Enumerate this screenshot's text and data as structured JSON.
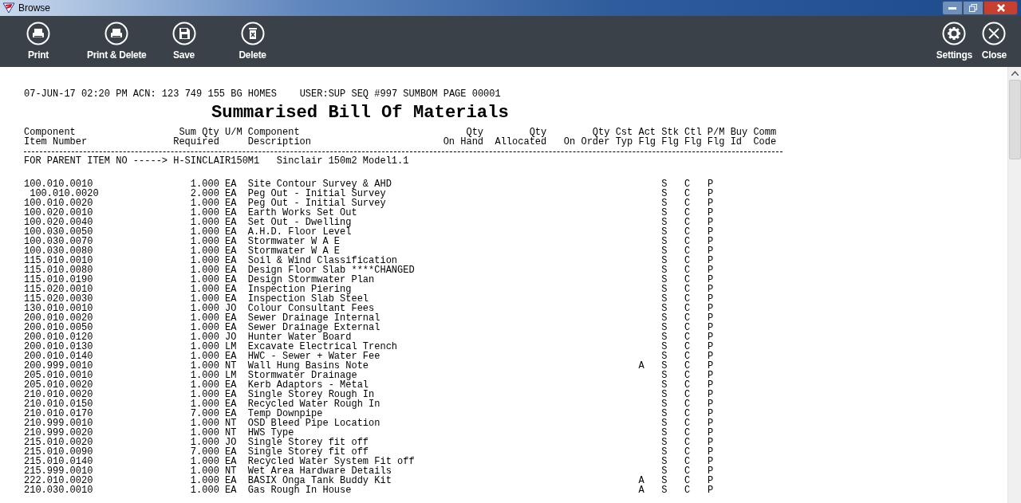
{
  "window": {
    "title": "Browse"
  },
  "toolbar": {
    "left": [
      {
        "label": "Print",
        "kind": "print"
      },
      {
        "label": "Print & Delete",
        "kind": "printdelete"
      },
      {
        "label": "Save",
        "kind": "save"
      },
      {
        "label": "Delete",
        "kind": "delete"
      }
    ],
    "right": [
      {
        "label": "Settings",
        "kind": "settings"
      },
      {
        "label": "Close",
        "kind": "close"
      }
    ]
  },
  "report": {
    "header_left": "07-JUN-17 02:20 PM ACN: 123 749 155  BG HOMES",
    "header_right": "USER:SUP SEQ #997 SUMBOM PAGE 00001",
    "title": "Summarised Bill Of Materials",
    "columns": [
      {
        "lines": [
          "Component",
          "Item Number"
        ]
      },
      {
        "lines": [
          "Sum Qty",
          "Required"
        ]
      },
      {
        "lines": [
          "U/M"
        ]
      },
      {
        "lines": [
          "Component",
          "Description"
        ]
      },
      {
        "lines": [
          "Qty",
          "On Hand"
        ]
      },
      {
        "lines": [
          "Qty",
          "Allocated"
        ]
      },
      {
        "lines": [
          "Qty",
          "On Order"
        ]
      },
      {
        "lines": [
          "Cst",
          "Typ"
        ]
      },
      {
        "lines": [
          "Act",
          "Flg"
        ]
      },
      {
        "lines": [
          "Stk",
          "Flg"
        ]
      },
      {
        "lines": [
          "Ctl",
          "Flg"
        ]
      },
      {
        "lines": [
          "P/M",
          "Flg"
        ]
      },
      {
        "lines": [
          "Buy",
          "Id"
        ]
      },
      {
        "lines": [
          "Comm",
          "Code"
        ]
      }
    ],
    "parent": {
      "label": "FOR PARENT ITEM NO ----->",
      "item": "H-SINCLAIR150M1",
      "description": "Sinclair 150m2 Model1.1"
    },
    "rows": [
      {
        "item": "100.010.0010",
        "indented": false,
        "qty": "1.000",
        "um": "EA",
        "description": "Site Contour Survey & AHD",
        "act": "",
        "stk": "S",
        "ctl": "C",
        "pm": "P"
      },
      {
        "item": "100.010.0020",
        "indented": true,
        "qty": "2.000",
        "um": "EA",
        "description": "Peg Out - Initial Survey",
        "act": "",
        "stk": "S",
        "ctl": "C",
        "pm": "P"
      },
      {
        "item": "100.010.0020",
        "indented": false,
        "qty": "1.000",
        "um": "EA",
        "description": "Peg Out - Initial Survey",
        "act": "",
        "stk": "S",
        "ctl": "C",
        "pm": "P"
      },
      {
        "item": "100.020.0010",
        "indented": false,
        "qty": "1.000",
        "um": "EA",
        "description": "Earth Works Set Out",
        "act": "",
        "stk": "S",
        "ctl": "C",
        "pm": "P"
      },
      {
        "item": "100.020.0040",
        "indented": false,
        "qty": "1.000",
        "um": "EA",
        "description": "Set Out - Dwelling",
        "act": "",
        "stk": "S",
        "ctl": "C",
        "pm": "P"
      },
      {
        "item": "100.030.0050",
        "indented": false,
        "qty": "1.000",
        "um": "EA",
        "description": "A.H.D. Floor Level",
        "act": "",
        "stk": "S",
        "ctl": "C",
        "pm": "P"
      },
      {
        "item": "100.030.0070",
        "indented": false,
        "qty": "1.000",
        "um": "EA",
        "description": "Stormwater W A E",
        "act": "",
        "stk": "S",
        "ctl": "C",
        "pm": "P"
      },
      {
        "item": "100.030.0080",
        "indented": false,
        "qty": "1.000",
        "um": "EA",
        "description": "Stormwater W A E",
        "act": "",
        "stk": "S",
        "ctl": "C",
        "pm": "P"
      },
      {
        "item": "115.010.0010",
        "indented": false,
        "qty": "1.000",
        "um": "EA",
        "description": "Soil & Wind Classification",
        "act": "",
        "stk": "S",
        "ctl": "C",
        "pm": "P"
      },
      {
        "item": "115.010.0080",
        "indented": false,
        "qty": "1.000",
        "um": "EA",
        "description": "Design Floor Slab ****CHANGED",
        "act": "",
        "stk": "S",
        "ctl": "C",
        "pm": "P"
      },
      {
        "item": "115.010.0190",
        "indented": false,
        "qty": "1.000",
        "um": "EA",
        "description": "Design Stormwater Plan",
        "act": "",
        "stk": "S",
        "ctl": "C",
        "pm": "P"
      },
      {
        "item": "115.020.0010",
        "indented": false,
        "qty": "1.000",
        "um": "EA",
        "description": "Inspection Piering",
        "act": "",
        "stk": "S",
        "ctl": "C",
        "pm": "P"
      },
      {
        "item": "115.020.0030",
        "indented": false,
        "qty": "1.000",
        "um": "EA",
        "description": "Inspection Slab Steel",
        "act": "",
        "stk": "S",
        "ctl": "C",
        "pm": "P"
      },
      {
        "item": "130.010.0010",
        "indented": false,
        "qty": "1.000",
        "um": "JO",
        "description": "Colour Consultant Fees",
        "act": "",
        "stk": "S",
        "ctl": "C",
        "pm": "P"
      },
      {
        "item": "200.010.0020",
        "indented": false,
        "qty": "1.000",
        "um": "EA",
        "description": "Sewer Drainage Internal",
        "act": "",
        "stk": "S",
        "ctl": "C",
        "pm": "P"
      },
      {
        "item": "200.010.0050",
        "indented": false,
        "qty": "1.000",
        "um": "EA",
        "description": "Sewer Drainage External",
        "act": "",
        "stk": "S",
        "ctl": "C",
        "pm": "P"
      },
      {
        "item": "200.010.0120",
        "indented": false,
        "qty": "1.000",
        "um": "JO",
        "description": "Hunter Water Board",
        "act": "",
        "stk": "S",
        "ctl": "C",
        "pm": "P"
      },
      {
        "item": "200.010.0130",
        "indented": false,
        "qty": "1.000",
        "um": "LM",
        "description": "Excavate Electrical Trench",
        "act": "",
        "stk": "S",
        "ctl": "C",
        "pm": "P"
      },
      {
        "item": "200.010.0140",
        "indented": false,
        "qty": "1.000",
        "um": "EA",
        "description": "HWC - Sewer + Water Fee",
        "act": "",
        "stk": "S",
        "ctl": "C",
        "pm": "P"
      },
      {
        "item": "200.999.0010",
        "indented": false,
        "qty": "1.000",
        "um": "NT",
        "description": "Wall Hung Basins Note",
        "act": "A",
        "stk": "S",
        "ctl": "C",
        "pm": "P"
      },
      {
        "item": "205.010.0010",
        "indented": false,
        "qty": "1.000",
        "um": "LM",
        "description": "Stormwater Drainage",
        "act": "",
        "stk": "S",
        "ctl": "C",
        "pm": "P"
      },
      {
        "item": "205.010.0020",
        "indented": false,
        "qty": "1.000",
        "um": "EA",
        "description": "Kerb Adaptors - Metal",
        "act": "",
        "stk": "S",
        "ctl": "C",
        "pm": "P"
      },
      {
        "item": "210.010.0020",
        "indented": false,
        "qty": "1.000",
        "um": "EA",
        "description": "Single Storey Rough In",
        "act": "",
        "stk": "S",
        "ctl": "C",
        "pm": "P"
      },
      {
        "item": "210.010.0150",
        "indented": false,
        "qty": "1.000",
        "um": "EA",
        "description": "Recycled Water Rough In",
        "act": "",
        "stk": "S",
        "ctl": "C",
        "pm": "P"
      },
      {
        "item": "210.010.0170",
        "indented": false,
        "qty": "7.000",
        "um": "EA",
        "description": "Temp Downpipe",
        "act": "",
        "stk": "S",
        "ctl": "C",
        "pm": "P"
      },
      {
        "item": "210.999.0010",
        "indented": false,
        "qty": "1.000",
        "um": "NT",
        "description": "OSD Bleed Pipe Location",
        "act": "",
        "stk": "S",
        "ctl": "C",
        "pm": "P"
      },
      {
        "item": "210.999.0020",
        "indented": false,
        "qty": "1.000",
        "um": "NT",
        "description": "HWS Type",
        "act": "",
        "stk": "S",
        "ctl": "C",
        "pm": "P"
      },
      {
        "item": "215.010.0020",
        "indented": false,
        "qty": "1.000",
        "um": "JO",
        "description": "Single Storey fit off",
        "act": "",
        "stk": "S",
        "ctl": "C",
        "pm": "P"
      },
      {
        "item": "215.010.0090",
        "indented": false,
        "qty": "7.000",
        "um": "EA",
        "description": "Single Storey fit off",
        "act": "",
        "stk": "S",
        "ctl": "C",
        "pm": "P"
      },
      {
        "item": "215.010.0140",
        "indented": false,
        "qty": "1.000",
        "um": "EA",
        "description": "Recycled Water System Fit off",
        "act": "",
        "stk": "S",
        "ctl": "C",
        "pm": "P"
      },
      {
        "item": "215.999.0010",
        "indented": false,
        "qty": "1.000",
        "um": "NT",
        "description": "Wet Area Hardware Details",
        "act": "",
        "stk": "S",
        "ctl": "C",
        "pm": "P"
      },
      {
        "item": "222.010.0020",
        "indented": false,
        "qty": "1.000",
        "um": "EA",
        "description": "BASIX Onga Tank Buddy Kit",
        "act": "A",
        "stk": "S",
        "ctl": "C",
        "pm": "P"
      },
      {
        "item": "210.030.0010",
        "indented": false,
        "qty": "1.000",
        "um": "EA",
        "description": "Gas Rough In House",
        "act": "A",
        "stk": "S",
        "ctl": "C",
        "pm": "P"
      }
    ]
  }
}
